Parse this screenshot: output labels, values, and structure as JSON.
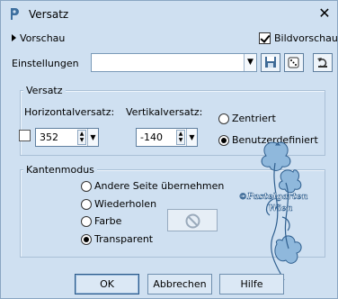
{
  "title": "Versatz",
  "preview": {
    "label": "Vorschau",
    "bildvorschau_label": "Bildvorschau",
    "bildvorschau_checked": true
  },
  "settings": {
    "label": "Einstellungen",
    "value": ""
  },
  "offset_group": {
    "title": "Versatz",
    "horizontal_label": "Horizontalversatz:",
    "horizontal_value": "352",
    "vertical_label": "Vertikalversatz:",
    "vertical_value": "-140",
    "centered_label": "Zentriert",
    "custom_label": "Benutzerdefiniert",
    "selected": "custom",
    "link_checked": false
  },
  "edge_group": {
    "title": "Kantenmodus",
    "options": [
      "Andere Seite übernehmen",
      "Wiederholen",
      "Farbe",
      "Transparent"
    ],
    "selected_index": 3
  },
  "watermark": {
    "line1": "©Pastelgarten",
    "line2": "Wien"
  },
  "buttons": {
    "ok": "OK",
    "cancel": "Abbrechen",
    "help": "Hilfe"
  },
  "colors": {
    "background": "#cfe0f1",
    "border": "#5f7f9f",
    "watermark": "#4a7fb5"
  }
}
